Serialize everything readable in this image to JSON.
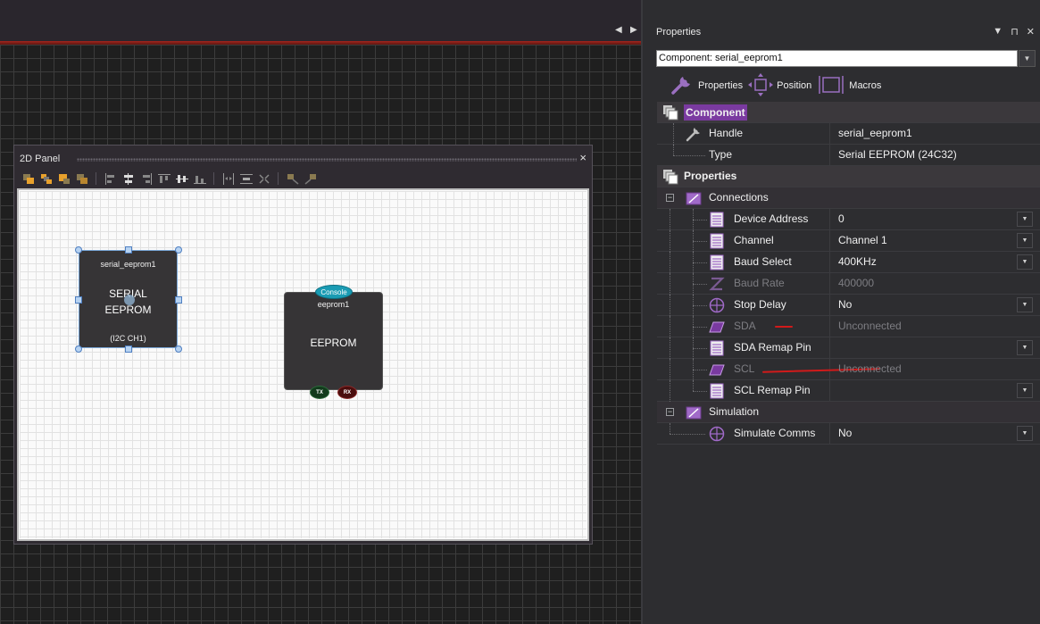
{
  "panel": {
    "title": "2D Panel",
    "close": "×",
    "components": [
      {
        "label": "serial_eeprom1",
        "title_line1": "SERIAL",
        "title_line2": "EEPROM",
        "subtitle": "(I2C CH1)"
      },
      {
        "badge": "Console",
        "label": "eeprom1",
        "title": "EEPROM",
        "ports": [
          "TX",
          "RX"
        ]
      }
    ]
  },
  "colors": {
    "accent": "#7a3aa0",
    "selection": "#7aa7d8",
    "console": "#1a9bb3",
    "tx": "#123a1c",
    "rx": "#4a0d0d",
    "annotation": "#d11a1a"
  },
  "properties": {
    "title": "Properties",
    "component_select": "Component: serial_eeprom1",
    "tabs": [
      {
        "label": "Properties",
        "icon": "wrench-icon"
      },
      {
        "label": "Position",
        "icon": "move-icon"
      },
      {
        "label": "Macros",
        "icon": "chip-icon"
      }
    ],
    "section_component": "Component",
    "handle": {
      "name": "Handle",
      "value": "serial_eeprom1"
    },
    "type": {
      "name": "Type",
      "value": "Serial EEPROM (24C32)"
    },
    "section_properties": "Properties",
    "connections": "Connections",
    "rows": [
      {
        "name": "Device Address",
        "value": "0"
      },
      {
        "name": "Channel",
        "value": "Channel 1"
      },
      {
        "name": "Baud Select",
        "value": "400KHz"
      },
      {
        "name": "Baud Rate",
        "value": "400000"
      },
      {
        "name": "Stop Delay",
        "value": "No"
      },
      {
        "name": "SDA",
        "value": "Unconnected"
      },
      {
        "name": "SDA Remap Pin",
        "value": ""
      },
      {
        "name": "SCL",
        "value": "Unconnected"
      },
      {
        "name": "SCL Remap Pin",
        "value": ""
      }
    ],
    "simulation": "Simulation",
    "simulate_comms": {
      "name": "Simulate Comms",
      "value": "No"
    }
  }
}
